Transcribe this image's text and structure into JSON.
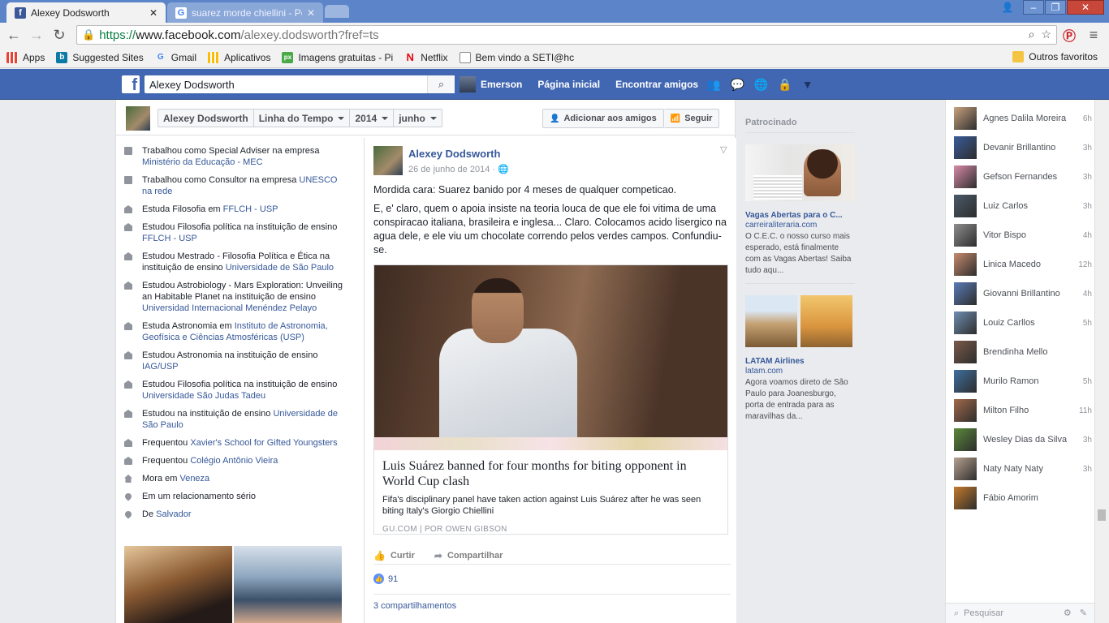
{
  "browser": {
    "tabs": [
      {
        "title": "Alexey Dodsworth",
        "icon": "facebook-icon",
        "active": true
      },
      {
        "title": "suarez morde chiellini - Pe",
        "icon": "google-icon",
        "active": false
      }
    ],
    "url_scheme": "https://",
    "url_host": "www.facebook.com",
    "url_path": "/alexey.dodsworth?fref=ts",
    "bookmarks": [
      {
        "label": "Apps",
        "icon": "apps-grid-icon"
      },
      {
        "label": "Suggested Sites",
        "icon": "bing-icon"
      },
      {
        "label": "Gmail",
        "icon": "google-icon"
      },
      {
        "label": "Aplicativos",
        "icon": "apps-grid-icon"
      },
      {
        "label": "Imagens gratuitas - Pi",
        "icon": "pixabay-icon"
      },
      {
        "label": "Netflix",
        "icon": "netflix-icon"
      },
      {
        "label": "Bem vindo a SETI@hc",
        "icon": "page-icon"
      }
    ],
    "other_bookmarks": "Outros favoritos"
  },
  "fb_header": {
    "search_value": "Alexey Dodsworth",
    "user_name": "Emerson",
    "nav": [
      "Página inicial",
      "Encontrar amigos"
    ],
    "color": "#4267b2"
  },
  "timeline_bar": {
    "crumbs": [
      "Alexey Dodsworth",
      "Linha do Tempo",
      "2014",
      "junho"
    ],
    "add_friend": "Adicionar aos amigos",
    "follow": "Seguir"
  },
  "about": [
    {
      "icon": "work-icon",
      "text": "Trabalhou como Special Adviser na empresa ",
      "link": "Ministério da Educação - MEC"
    },
    {
      "icon": "work-icon",
      "text": "Trabalhou como Consultor na empresa ",
      "link": "UNESCO na rede"
    },
    {
      "icon": "education-icon",
      "text": "Estuda Filosofia em ",
      "link": "FFLCH - USP"
    },
    {
      "icon": "education-icon",
      "text": "Estudou Filosofia política na instituição de ensino ",
      "link": "FFLCH - USP"
    },
    {
      "icon": "education-icon",
      "text": "Estudou Mestrado - Filosofia Política e Ética na instituição de ensino ",
      "link": "Universidade de São Paulo"
    },
    {
      "icon": "education-icon",
      "text": "Estudou Astrobiology - Mars Exploration: Unveiling an Habitable Planet na instituição de ensino ",
      "link": "Universidad Internacional Menéndez Pelayo"
    },
    {
      "icon": "education-icon",
      "text": "Estuda Astronomia em ",
      "link": "Instituto de Astronomia, Geofísica e Ciências Atmosféricas (USP)"
    },
    {
      "icon": "education-icon",
      "text": "Estudou Astronomia na instituição de ensino ",
      "link": "IAG/USP"
    },
    {
      "icon": "education-icon",
      "text": "Estudou Filosofia política na instituição de ensino ",
      "link": "Universidade São Judas Tadeu"
    },
    {
      "icon": "education-icon",
      "text": "Estudou na instituição de ensino ",
      "link": "Universidade de São Paulo"
    },
    {
      "icon": "education-icon",
      "text": "Frequentou ",
      "link": "Xavier's School for Gifted Youngsters"
    },
    {
      "icon": "education-icon",
      "text": "Frequentou ",
      "link": "Colégio Antônio Vieira"
    },
    {
      "icon": "home-icon",
      "text": "Mora em ",
      "link": "Veneza"
    },
    {
      "icon": "heart-icon",
      "text": "Em um relacionamento sério",
      "link": ""
    },
    {
      "icon": "location-pin-icon",
      "text": "De ",
      "link": "Salvador"
    }
  ],
  "post": {
    "author": "Alexey Dodsworth",
    "date": "26 de junho de 2014 ·",
    "paragraphs": [
      "Mordida cara: Suarez banido por 4 meses de qualquer competicao.",
      "E, e' claro, quem o apoia insiste na teoria louca de que ele foi vitima de uma conspiracao italiana, brasileira e inglesa... Claro. Colocamos acido lisergico na agua dele, e ele viu um chocolate correndo pelos verdes campos. Confundiu-se."
    ],
    "link_title": "Luis Suárez banned for four months for biting opponent in World Cup clash",
    "link_desc": "Fifa's disciplinary panel have taken action against Luis Suárez after he was seen biting Italy's Giorgio Chiellini",
    "link_source": "GU.COM | POR OWEN GIBSON",
    "like_label": "Curtir",
    "share_label": "Compartilhar",
    "likes": "91",
    "shares": "3 compartilhamentos"
  },
  "ads": {
    "header": "Patrocinado",
    "items": [
      {
        "title": "Vagas Abertas para o C...",
        "url": "carreiraliteraria.com",
        "text": "O C.E.C. o nosso curso mais esperado, está finalmente com as Vagas Abertas! Saiba tudo aqu..."
      },
      {
        "title": "LATAM Airlines",
        "url": "latam.com",
        "text": "Agora voamos direto de São Paulo para Joanesburgo, porta de entrada para as maravilhas da..."
      }
    ]
  },
  "chat": {
    "friends": [
      {
        "name": "Agnes Dalila Moreira",
        "time": "6h"
      },
      {
        "name": "Devanir Brillantino",
        "time": "3h"
      },
      {
        "name": "Gefson Fernandes",
        "time": "3h"
      },
      {
        "name": "Luiz Carlos",
        "time": "3h"
      },
      {
        "name": "Vitor Bispo",
        "time": "4h"
      },
      {
        "name": "Linica Macedo",
        "time": "12h"
      },
      {
        "name": "Giovanni Brillantino",
        "time": "4h"
      },
      {
        "name": "Louiz Carllos",
        "time": "5h"
      },
      {
        "name": "Brendinha Mello",
        "time": ""
      },
      {
        "name": "Murilo Ramon",
        "time": "5h"
      },
      {
        "name": "Milton Filho",
        "time": "11h"
      },
      {
        "name": "Wesley Dias da Silva",
        "time": "3h"
      },
      {
        "name": "Naty Naty Naty",
        "time": "3h"
      },
      {
        "name": "Fábio Amorim",
        "time": ""
      }
    ],
    "search_placeholder": "Pesquisar"
  }
}
